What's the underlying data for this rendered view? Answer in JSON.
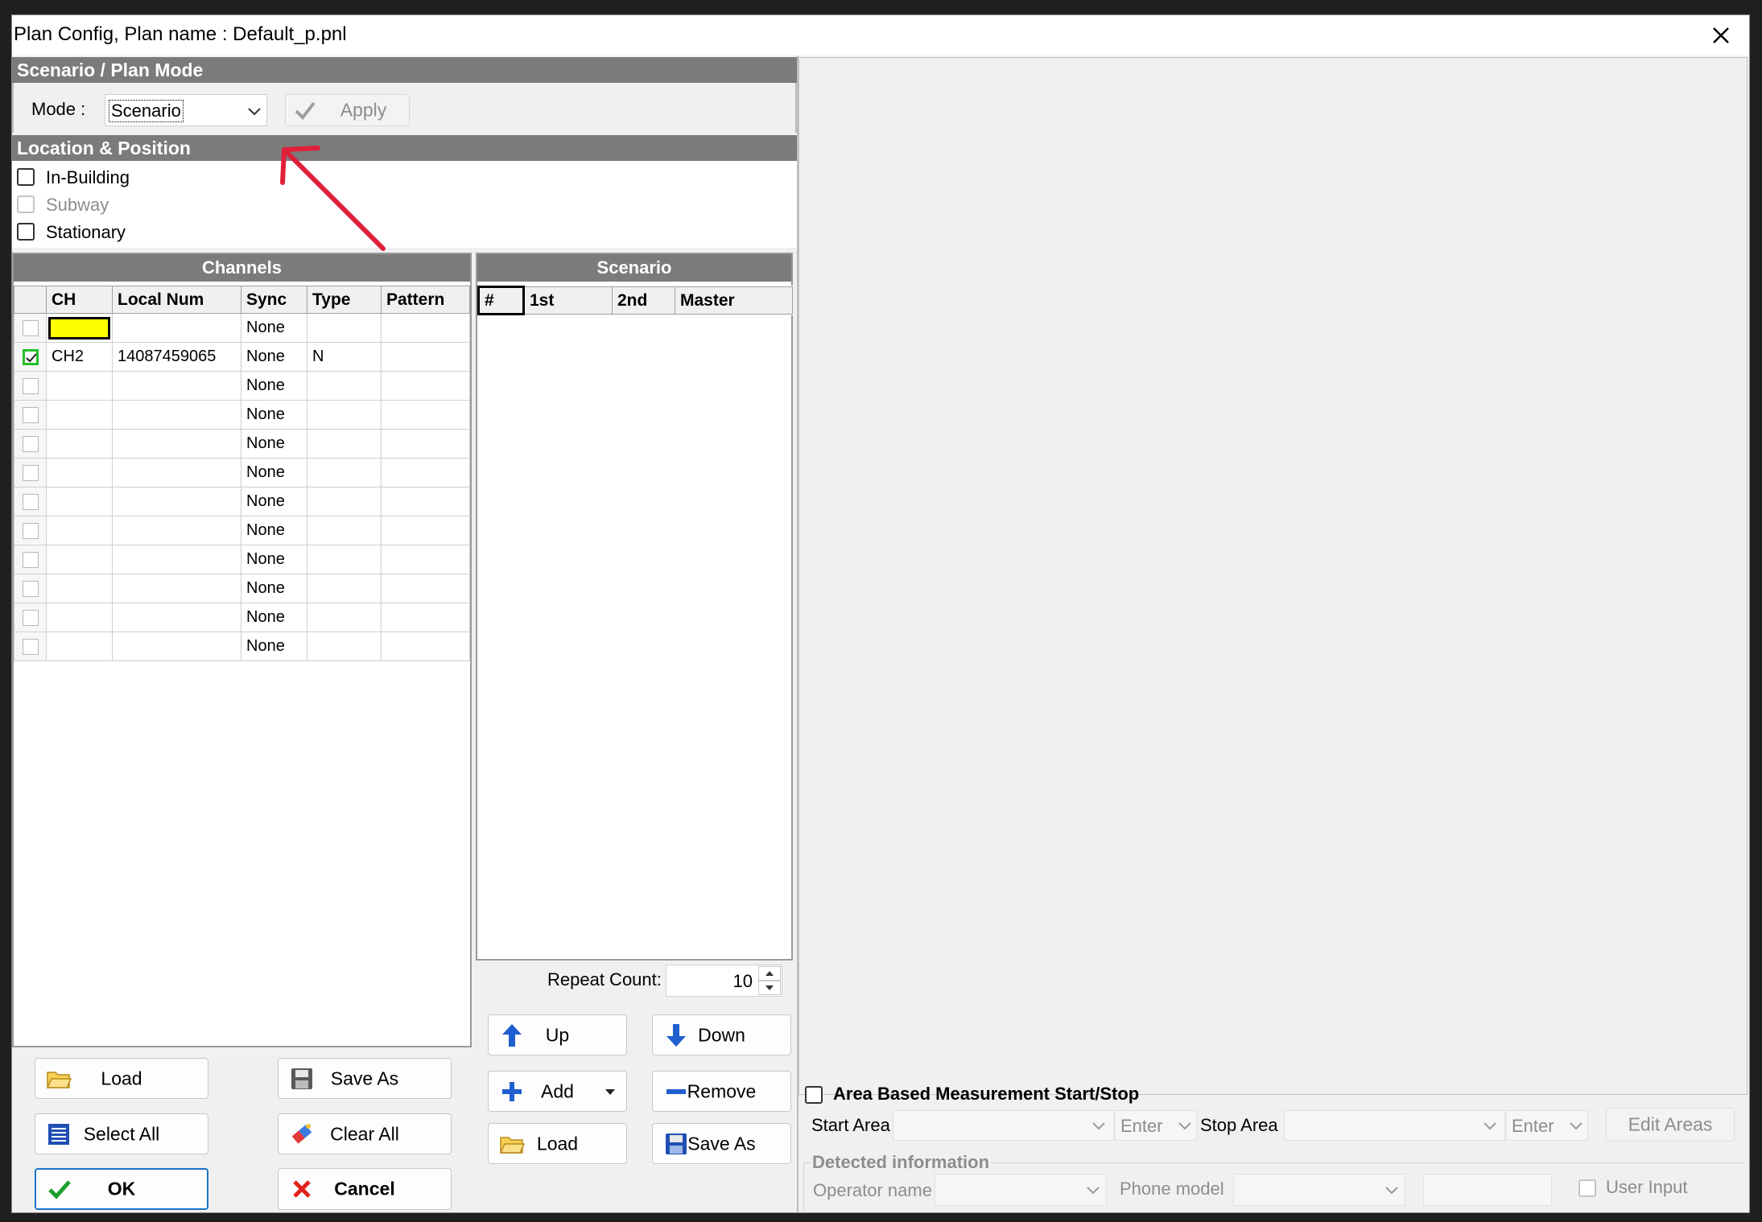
{
  "window": {
    "title": "Plan Config, Plan name : Default_p.pnl"
  },
  "mode_section": {
    "header": "Scenario / Plan Mode",
    "mode_label": "Mode :",
    "mode_value": "Scenario",
    "apply_label": "Apply"
  },
  "location_section": {
    "header": "Location & Position",
    "options": [
      {
        "label": "In-Building",
        "checked": false,
        "enabled": true
      },
      {
        "label": "Subway",
        "checked": false,
        "enabled": false
      },
      {
        "label": "Stationary",
        "checked": false,
        "enabled": true
      }
    ]
  },
  "channels": {
    "header": "Channels",
    "columns": [
      "",
      "CH",
      "Local Num",
      "Sync",
      "Type",
      "Pattern"
    ],
    "rows": [
      {
        "checked": false,
        "ch": "",
        "local_num": "",
        "sync": "None",
        "type": "",
        "pattern": ""
      },
      {
        "checked": true,
        "ch": "CH2",
        "local_num": "14087459065",
        "sync": "None",
        "type": "N",
        "pattern": ""
      },
      {
        "checked": false,
        "ch": "",
        "local_num": "",
        "sync": "None",
        "type": "",
        "pattern": ""
      },
      {
        "checked": false,
        "ch": "",
        "local_num": "",
        "sync": "None",
        "type": "",
        "pattern": ""
      },
      {
        "checked": false,
        "ch": "",
        "local_num": "",
        "sync": "None",
        "type": "",
        "pattern": ""
      },
      {
        "checked": false,
        "ch": "",
        "local_num": "",
        "sync": "None",
        "type": "",
        "pattern": ""
      },
      {
        "checked": false,
        "ch": "",
        "local_num": "",
        "sync": "None",
        "type": "",
        "pattern": ""
      },
      {
        "checked": false,
        "ch": "",
        "local_num": "",
        "sync": "None",
        "type": "",
        "pattern": ""
      },
      {
        "checked": false,
        "ch": "",
        "local_num": "",
        "sync": "None",
        "type": "",
        "pattern": ""
      },
      {
        "checked": false,
        "ch": "",
        "local_num": "",
        "sync": "None",
        "type": "",
        "pattern": ""
      },
      {
        "checked": false,
        "ch": "",
        "local_num": "",
        "sync": "None",
        "type": "",
        "pattern": ""
      },
      {
        "checked": false,
        "ch": "",
        "local_num": "",
        "sync": "None",
        "type": "",
        "pattern": ""
      }
    ],
    "buttons": {
      "load": "Load",
      "save_as": "Save As",
      "select_all": "Select All",
      "clear_all": "Clear All",
      "ok": "OK",
      "cancel": "Cancel"
    }
  },
  "scenario": {
    "header": "Scenario",
    "columns": [
      "#",
      "1st",
      "2nd",
      "Master"
    ],
    "repeat_label": "Repeat Count:",
    "repeat_value": "10",
    "buttons": {
      "up": "Up",
      "down": "Down",
      "add": "Add",
      "remove": "Remove",
      "load": "Load",
      "save_as": "Save As"
    }
  },
  "area": {
    "header": "Area Based Measurement Start/Stop",
    "start_label": "Start Area",
    "start_enter": "Enter",
    "stop_label": "Stop Area",
    "stop_enter": "Enter",
    "edit_label": "Edit Areas"
  },
  "detected": {
    "header": "Detected information",
    "operator_label": "Operator name",
    "phone_label": "Phone model",
    "user_input_label": "User Input"
  },
  "colors": {
    "section_header": "#7b7b7b",
    "selected_cell": "#ffff00",
    "check_green": "#22c02a",
    "ok_border": "#1a73c8",
    "cancel_red": "#e0201b"
  }
}
